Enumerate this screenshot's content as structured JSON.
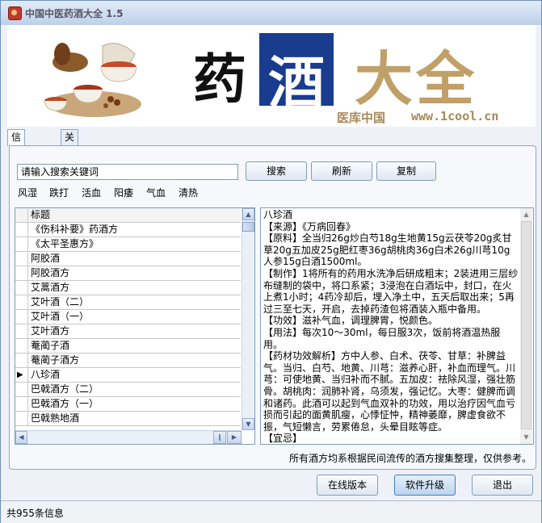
{
  "window": {
    "title": "中国中医药酒大全 1.5"
  },
  "banner": {
    "yao": "药",
    "jiu": "酒",
    "daquan": "大全",
    "site_name": "医库中国",
    "site_url": "www.1cool.cn"
  },
  "tabs": [
    {
      "label": "信息管理",
      "active": true
    },
    {
      "label": "关于我们",
      "active": false
    }
  ],
  "search": {
    "value": "请输入搜索关键词",
    "search_label": "搜索",
    "refresh_label": "刷新",
    "copy_label": "复制"
  },
  "categories": [
    "风湿",
    "跌打",
    "活血",
    "阳痿",
    "气血",
    "清热"
  ],
  "recipe_list": {
    "header": "标题",
    "rows": [
      "《伤科补要》药酒方",
      "《太平圣惠方》",
      "阿胶酒",
      "阿胶酒方",
      "艾蒿酒方",
      "艾叶酒（二）",
      "艾叶酒（一）",
      "艾叶酒方",
      "菴蔺子酒",
      "菴蔺子酒方",
      "八珍酒",
      "巴戟酒方（二）",
      "巴戟酒方（一）",
      "巴戟熟地酒"
    ],
    "current_index": 10
  },
  "detail": {
    "text": "八珍酒\n【来源】《万病回春》\n【原料】全当归26g炒白芍18g生地黄15g云茯苓20g炙甘草20g五加皮25g肥红枣36g胡桃肉36g白术26g川芎10g人参15g白酒1500ml。\n【制作】1将所有的药用水洗净后研成粗末；2装进用三层纱布缝制的袋中，将口系紧；3浸泡在白酒坛中，封口，在火上煮1小时；4药冷却后，埋入净土中，五天后取出来；5再过三至七天，开启，去掉药渣包将酒装入瓶中备用。\n【功效】滋补气血，调理脾胃，悦颜色。\n【用法】每次10～30ml，每日服3次，饭前将酒温热服用。\n【药材功效解析】方中人参、白术、茯苓、甘草：补脾益气。当归、白芍、地黄、川芎：滋养心肝，补血而理气。川芎：可使地黄、当归补而不腻。五加皮：祛除风湿，强壮筋骨。胡桃肉：润肺补肾，乌须发，强记忆。大枣：健脾而调和诸药。此酒可以起到气血双补的功效，用以治疗因气血亏损而引起的面黄肌瘦，心悸怔忡，精神萎靡，脾虚食欲不振，气短懒言，劳累倦怠，头晕目眩等症。\n【宜忌】"
  },
  "disclaimer": "所有酒方均系根据民间流传的酒方搜集整理，仅供参考。",
  "bottom_buttons": {
    "online_label": "在线版本",
    "upgrade_label": "软件升级",
    "exit_label": "退出"
  },
  "status": {
    "text": "共955条信息"
  },
  "colors": {
    "banner_blue": "#1a3c8e",
    "banner_gold": "#c0a068",
    "accent_blue": "#cfe0f5"
  }
}
